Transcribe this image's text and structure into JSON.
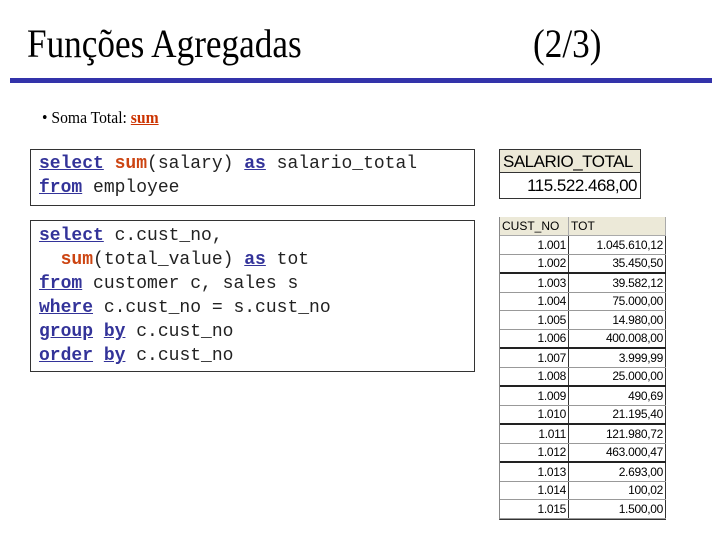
{
  "slide": {
    "title": "Funções Agregadas",
    "page_indicator": "(2/3)",
    "accent_color": "#3333aa"
  },
  "bullet": {
    "marker": "•",
    "label": "Soma Total: ",
    "keyword": "sum"
  },
  "query1": {
    "lines": [
      [
        {
          "type": "k",
          "text": "select"
        },
        {
          "type": "t",
          "text": " "
        },
        {
          "type": "f",
          "text": "sum"
        },
        {
          "type": "t",
          "text": "(salary) "
        },
        {
          "type": "k",
          "text": "as"
        },
        {
          "type": "t",
          "text": " salario_total"
        }
      ],
      [
        {
          "type": "k",
          "text": "from"
        },
        {
          "type": "t",
          "text": " employee"
        }
      ]
    ]
  },
  "query2": {
    "lines": [
      [
        {
          "type": "k",
          "text": "select"
        },
        {
          "type": "t",
          "text": " c.cust_no,"
        }
      ],
      [
        {
          "type": "t",
          "text": "  "
        },
        {
          "type": "f",
          "text": "sum"
        },
        {
          "type": "t",
          "text": "(total_value) "
        },
        {
          "type": "k",
          "text": "as"
        },
        {
          "type": "t",
          "text": " tot"
        }
      ],
      [
        {
          "type": "k",
          "text": "from"
        },
        {
          "type": "t",
          "text": " customer c, sales s"
        }
      ],
      [
        {
          "type": "k",
          "text": "where"
        },
        {
          "type": "t",
          "text": " c.cust_no = s.cust_no"
        }
      ],
      [
        {
          "type": "k",
          "text": "group"
        },
        {
          "type": "t",
          "text": " "
        },
        {
          "type": "k",
          "text": "by"
        },
        {
          "type": "t",
          "text": " c.cust_no"
        }
      ],
      [
        {
          "type": "k",
          "text": "order"
        },
        {
          "type": "t",
          "text": " "
        },
        {
          "type": "k",
          "text": "by"
        },
        {
          "type": "t",
          "text": " c.cust_no"
        }
      ]
    ]
  },
  "result1": {
    "header": "SALARIO_TOTAL",
    "value": "115.522.468,00"
  },
  "result2": {
    "columns": [
      "CUST_NO",
      "TOT"
    ],
    "rows": [
      [
        "1.001",
        "1.045.610,12"
      ],
      [
        "1.002",
        "35.450,50"
      ],
      [
        "1.003",
        "39.582,12"
      ],
      [
        "1.004",
        "75.000,00"
      ],
      [
        "1.005",
        "14.980,00"
      ],
      [
        "1.006",
        "400.008,00"
      ],
      [
        "1.007",
        "3.999,99"
      ],
      [
        "1.008",
        "25.000,00"
      ],
      [
        "1.009",
        "490,69"
      ],
      [
        "1.010",
        "21.195,40"
      ],
      [
        "1.011",
        "121.980,72"
      ],
      [
        "1.012",
        "463.000,47"
      ],
      [
        "1.013",
        "2.693,00"
      ],
      [
        "1.014",
        "100,02"
      ],
      [
        "1.015",
        "1.500,00"
      ]
    ]
  }
}
